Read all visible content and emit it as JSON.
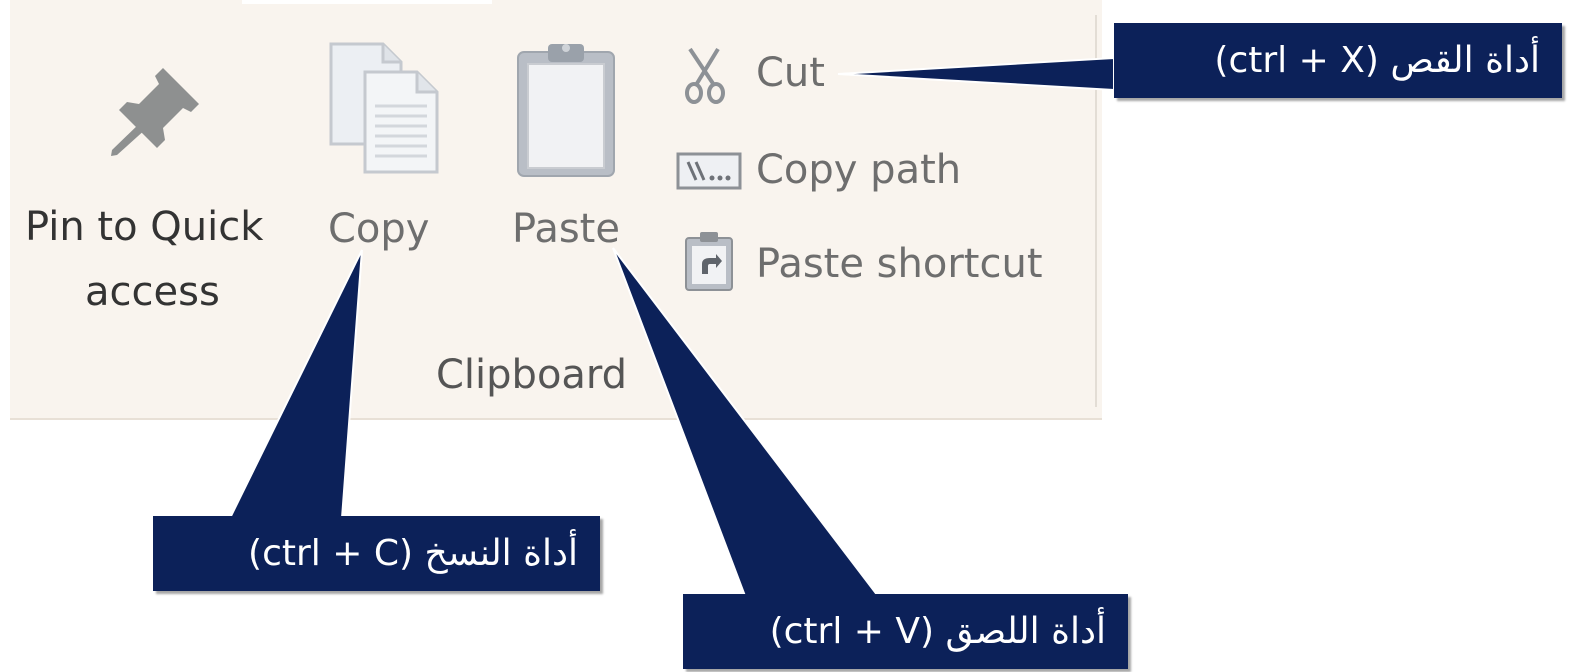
{
  "ribbon": {
    "pin_label_line1": "Pin to Quick",
    "pin_label_line2": "access",
    "copy_label": "Copy",
    "paste_label": "Paste",
    "cut_label": "Cut",
    "copy_path_label": "Copy path",
    "paste_shortcut_label": "Paste shortcut",
    "group_label": "Clipboard"
  },
  "callouts": {
    "cut": "أداة القص (ctrl + X)",
    "copy": "أداة النسخ  (ctrl + C)",
    "paste": "أداة اللصق  (ctrl + V)"
  },
  "colors": {
    "ribbon_bg": "#f9f4ee",
    "callout_bg": "#0c2159",
    "callout_text": "#ffffff",
    "enabled_text": "#333333",
    "disabled_text": "#6e6e6e"
  },
  "icons": {
    "pin": "pin-icon",
    "copy": "copy-icon",
    "paste": "clipboard-icon",
    "cut": "scissors-icon",
    "copy_path": "copy-path-icon",
    "paste_shortcut": "paste-shortcut-icon"
  }
}
